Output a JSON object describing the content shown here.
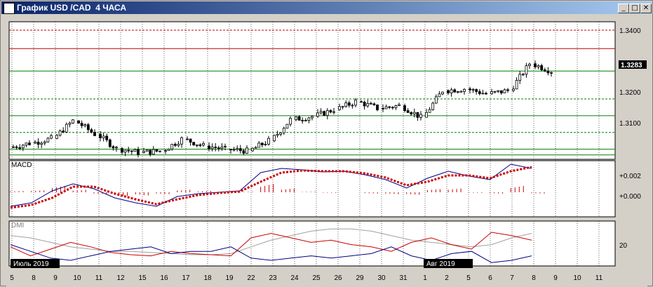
{
  "window": {
    "title": "График USD /CAD  4 ЧАСА",
    "minimize_glyph": "_",
    "maximize_glyph": "□",
    "close_glyph": "✕"
  },
  "colors": {
    "frame": "#d4d0c8",
    "plot_bg": "#ffffff",
    "grid": "#000000",
    "support_line": "#008000",
    "resistance_line": "#c00000",
    "price_tag_bg": "#000000",
    "macd_line": "#000080",
    "signal_line": "#cc0000",
    "histogram": "#cc0000",
    "dmi_plus": "#cc0000",
    "dmi_minus": "#000080",
    "adx": "#a0a0a0"
  },
  "chart_data": [
    {
      "type": "candlestick",
      "title": "",
      "price_axis_labels": [
        "1.3400",
        "1.3200",
        "1.3100"
      ],
      "current_price_label": "1.3283",
      "ylim": [
        1.302,
        1.343
      ],
      "horizontal_levels": [
        {
          "value": 1.3405,
          "color": "resistance",
          "style": "dashed"
        },
        {
          "value": 1.335,
          "color": "resistance",
          "style": "solid"
        },
        {
          "value": 1.3283,
          "color": "support",
          "style": "solid"
        },
        {
          "value": 1.32,
          "color": "support",
          "style": "dashed"
        },
        {
          "value": 1.315,
          "color": "support",
          "style": "solid"
        },
        {
          "value": 1.31,
          "color": "support",
          "style": "dashed"
        },
        {
          "value": 1.305,
          "color": "support",
          "style": "solid"
        },
        {
          "value": 1.3033,
          "color": "support",
          "style": "solid"
        }
      ],
      "closes_by_day": [
        {
          "day": "5",
          "open": 1.3055,
          "close": 1.3068
        },
        {
          "day": "8",
          "open": 1.3068,
          "close": 1.3082
        },
        {
          "day": "9",
          "open": 1.3082,
          "close": 1.3135
        },
        {
          "day": "10",
          "open": 1.3135,
          "close": 1.3095
        },
        {
          "day": "11",
          "open": 1.3095,
          "close": 1.3052
        },
        {
          "day": "12",
          "open": 1.3052,
          "close": 1.304
        },
        {
          "day": "15",
          "open": 1.304,
          "close": 1.3045
        },
        {
          "day": "16",
          "open": 1.3045,
          "close": 1.308
        },
        {
          "day": "17",
          "open": 1.308,
          "close": 1.306
        },
        {
          "day": "18",
          "open": 1.306,
          "close": 1.305
        },
        {
          "day": "19",
          "open": 1.305,
          "close": 1.3045
        },
        {
          "day": "22",
          "open": 1.3045,
          "close": 1.3075
        },
        {
          "day": "23",
          "open": 1.3075,
          "close": 1.3138
        },
        {
          "day": "24",
          "open": 1.3138,
          "close": 1.3148
        },
        {
          "day": "25",
          "open": 1.3148,
          "close": 1.3168
        },
        {
          "day": "26",
          "open": 1.3168,
          "close": 1.3192
        },
        {
          "day": "29",
          "open": 1.3192,
          "close": 1.3172
        },
        {
          "day": "30",
          "open": 1.3172,
          "close": 1.318
        },
        {
          "day": "31",
          "open": 1.318,
          "close": 1.3145
        },
        {
          "day": "1",
          "open": 1.3145,
          "close": 1.3225
        },
        {
          "day": "2",
          "open": 1.3225,
          "close": 1.323
        },
        {
          "day": "5",
          "open": 1.323,
          "close": 1.3215
        },
        {
          "day": "6",
          "open": 1.3215,
          "close": 1.3225
        },
        {
          "day": "7",
          "open": 1.3225,
          "close": 1.3305
        },
        {
          "day": "8",
          "open": 1.3305,
          "close": 1.3283
        }
      ]
    },
    {
      "type": "line",
      "title": "MACD",
      "axis_labels": [
        "+0.002",
        "+0.000"
      ],
      "ylim": [
        -0.0035,
        0.0045
      ],
      "series": [
        {
          "role": "macd",
          "values": [
            -0.002,
            -0.0015,
            0.0002,
            0.0012,
            0.0005,
            -0.0008,
            -0.0015,
            -0.002,
            -0.0006,
            -0.0002,
            0.0,
            0.0002,
            0.0028,
            0.0034,
            0.0032,
            0.0029,
            0.003,
            0.0025,
            0.0018,
            0.0006,
            0.002,
            0.003,
            0.0023,
            0.0018,
            0.004,
            0.0034
          ]
        },
        {
          "role": "signal",
          "values": [
            -0.0022,
            -0.0018,
            -0.0008,
            0.0008,
            0.0008,
            -0.0002,
            -0.001,
            -0.0017,
            -0.001,
            -0.0004,
            -0.0001,
            0.0001,
            0.0015,
            0.0028,
            0.0031,
            0.003,
            0.003,
            0.0027,
            0.0021,
            0.001,
            0.0015,
            0.0024,
            0.0024,
            0.002,
            0.003,
            0.0036
          ]
        }
      ],
      "histogram": [
        0.0002,
        0.0003,
        0.001,
        0.0004,
        -0.0003,
        -0.0006,
        -0.0005,
        -0.0003,
        0.0004,
        0.0002,
        0.0001,
        0.0001,
        0.0013,
        0.0006,
        0.0001,
        -0.0001,
        0.0,
        -0.0002,
        -0.0003,
        -0.0004,
        0.0005,
        0.0006,
        -0.0001,
        -0.0002,
        0.001,
        -0.0002
      ]
    },
    {
      "type": "line",
      "title": "DMI",
      "axis_labels": [
        "20"
      ],
      "ylim": [
        5,
        45
      ],
      "series": [
        {
          "role": "plus_di",
          "values": [
            22,
            14,
            20,
            26,
            22,
            17,
            15,
            14,
            18,
            16,
            15,
            14,
            30,
            34,
            30,
            26,
            28,
            24,
            22,
            18,
            26,
            30,
            24,
            20,
            35,
            32,
            28
          ]
        },
        {
          "role": "minus_di",
          "values": [
            24,
            18,
            12,
            10,
            14,
            18,
            20,
            22,
            16,
            18,
            18,
            22,
            12,
            10,
            12,
            14,
            12,
            14,
            16,
            22,
            14,
            10,
            16,
            18,
            8,
            10,
            14
          ]
        },
        {
          "role": "adx",
          "values": [
            32,
            30,
            26,
            22,
            20,
            18,
            18,
            17,
            16,
            15,
            15,
            16,
            22,
            28,
            32,
            36,
            38,
            38,
            36,
            32,
            28,
            26,
            24,
            22,
            24,
            30,
            34
          ]
        }
      ]
    }
  ],
  "time_axis": {
    "month_labels": [
      {
        "text": "Июль 2019",
        "slot": 0
      },
      {
        "text": "Авг 2019",
        "slot": 19
      }
    ],
    "day_labels": [
      "5",
      "8",
      "9",
      "10",
      "11",
      "12",
      "15",
      "16",
      "17",
      "18",
      "19",
      "22",
      "23",
      "24",
      "25",
      "26",
      "29",
      "30",
      "31",
      "1",
      "2",
      "5",
      "6",
      "7",
      "8",
      "9",
      "10",
      "11"
    ]
  }
}
